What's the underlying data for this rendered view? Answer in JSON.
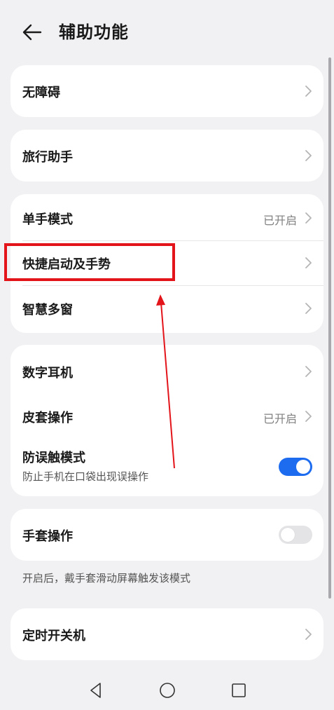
{
  "header": {
    "title": "辅助功能",
    "back_icon": "back-arrow-icon"
  },
  "sections": {
    "accessibility": {
      "label": "无障碍"
    },
    "travel_assistant": {
      "label": "旅行助手"
    },
    "one_hand_mode": {
      "label": "单手模式",
      "status": "已开启"
    },
    "shortcuts_gestures": {
      "label": "快捷启动及手势"
    },
    "smart_multiwindow": {
      "label": "智慧多窗"
    },
    "digital_earphone": {
      "label": "数字耳机"
    },
    "cover_operation": {
      "label": "皮套操作",
      "status": "已开启"
    },
    "anti_mistouch": {
      "label": "防误触模式",
      "subtitle": "防止手机在口袋出现误操作",
      "enabled": true
    },
    "glove_operation": {
      "label": "手套操作",
      "enabled": false,
      "hint": "开启后，戴手套滑动屏幕触发该模式"
    },
    "scheduled_power": {
      "label": "定时开关机"
    }
  },
  "colors": {
    "accent": "#1d6cf0",
    "annotation": "#e3141a",
    "background": "#f1f1f3"
  },
  "navbar": {
    "icons": [
      "back-triangle-icon",
      "home-circle-icon",
      "recents-square-icon"
    ]
  }
}
